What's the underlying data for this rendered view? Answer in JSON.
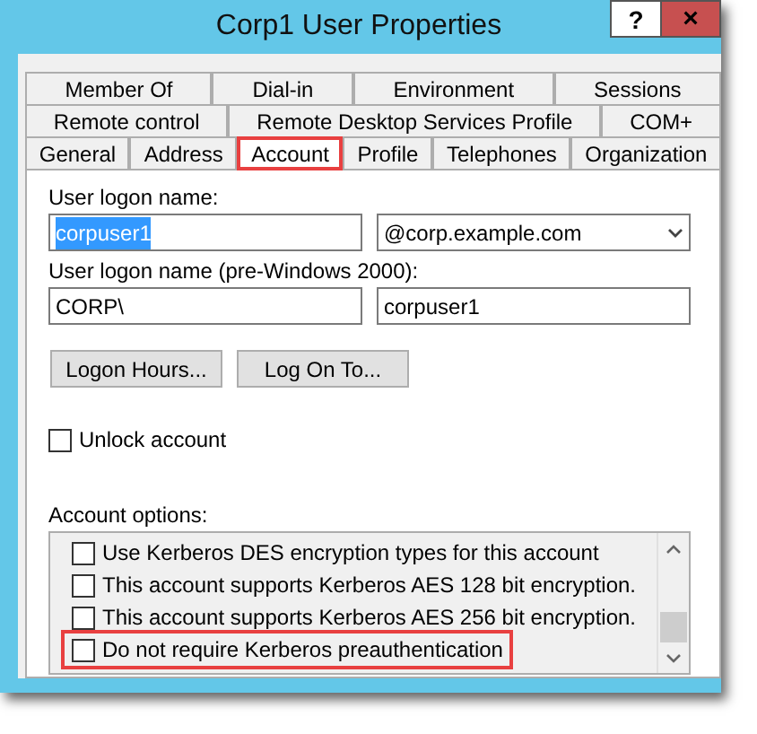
{
  "window": {
    "title": "Corp1 User Properties",
    "help_button": "?",
    "close_button": "×"
  },
  "tab_rows": [
    [
      {
        "label": "Member Of",
        "selected": false,
        "highlighted": false
      },
      {
        "label": "Dial-in",
        "selected": false,
        "highlighted": false
      },
      {
        "label": "Environment",
        "selected": false,
        "highlighted": false
      },
      {
        "label": "Sessions",
        "selected": false,
        "highlighted": false
      }
    ],
    [
      {
        "label": "Remote control",
        "selected": false,
        "highlighted": false
      },
      {
        "label": "Remote Desktop Services Profile",
        "selected": false,
        "highlighted": false
      },
      {
        "label": "COM+",
        "selected": false,
        "highlighted": false
      }
    ],
    [
      {
        "label": "General",
        "selected": false,
        "highlighted": false
      },
      {
        "label": "Address",
        "selected": false,
        "highlighted": false
      },
      {
        "label": "Account",
        "selected": true,
        "highlighted": true
      },
      {
        "label": "Profile",
        "selected": false,
        "highlighted": false
      },
      {
        "label": "Telephones",
        "selected": false,
        "highlighted": false
      },
      {
        "label": "Organization",
        "selected": false,
        "highlighted": false
      }
    ]
  ],
  "logon_name": {
    "label": "User logon name:",
    "value": "corpuser1",
    "value_selected": true,
    "domain": "@corp.example.com"
  },
  "pre2000": {
    "label": "User logon name (pre-Windows 2000):",
    "domain": "CORP\\",
    "value": "corpuser1"
  },
  "buttons": [
    "Logon Hours...",
    "Log On To..."
  ],
  "unlock": {
    "label": "Unlock account",
    "checked": false
  },
  "account_options": {
    "label": "Account options:",
    "items": [
      {
        "label": "Use Kerberos DES encryption types for this account",
        "checked": false,
        "highlighted": false
      },
      {
        "label": "This account supports Kerberos AES 128 bit encryption.",
        "checked": false,
        "highlighted": false
      },
      {
        "label": "This account supports Kerberos AES 256 bit encryption.",
        "checked": false,
        "highlighted": false
      },
      {
        "label": "Do not require Kerberos preauthentication",
        "checked": false,
        "highlighted": true
      }
    ]
  }
}
